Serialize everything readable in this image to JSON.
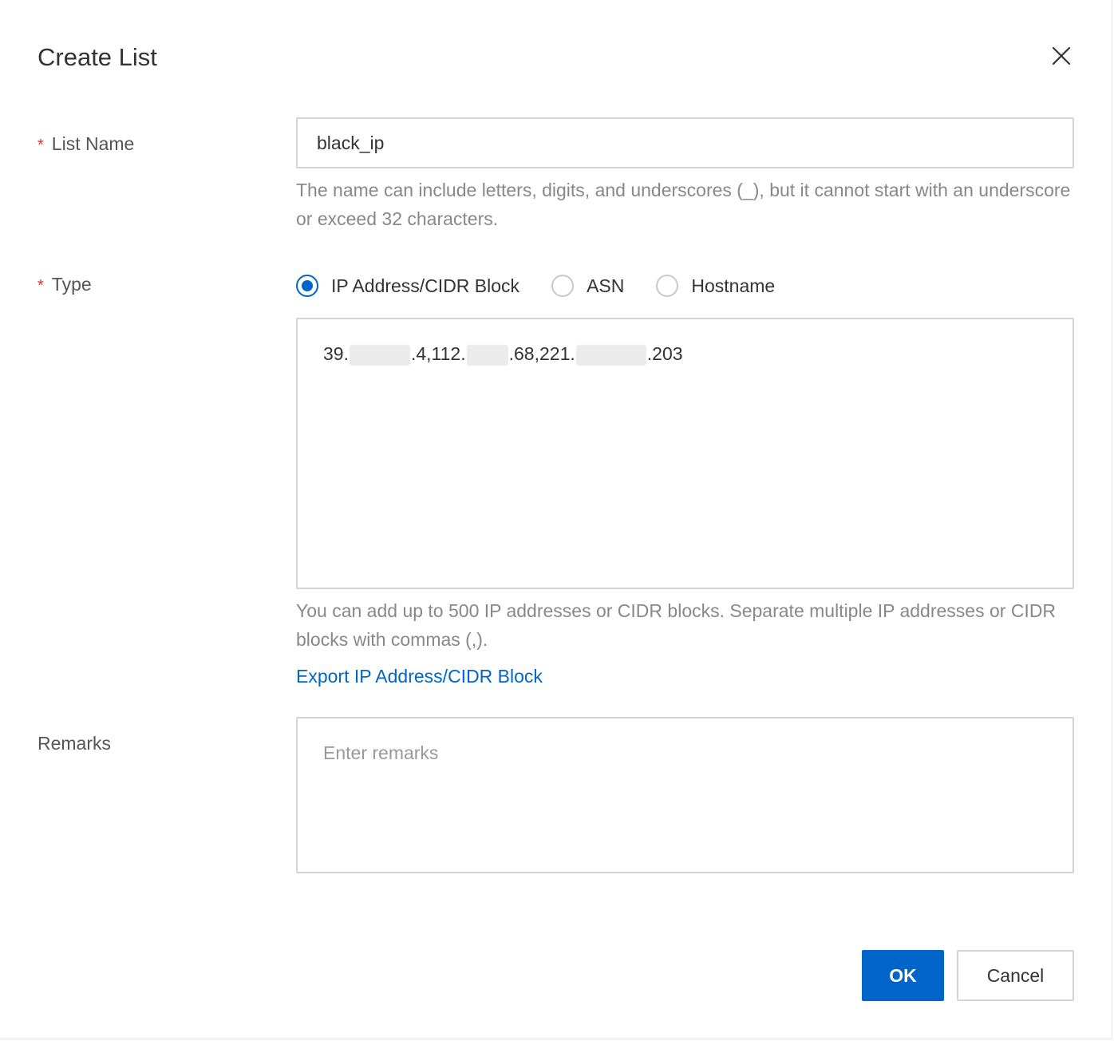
{
  "dialog": {
    "title": "Create List",
    "close_icon": "close-icon"
  },
  "list_name": {
    "required_mark": "*",
    "label": "List Name",
    "value": "black_ip",
    "help": "The name can include letters, digits, and underscores (_), but it cannot start with an underscore or exceed 32 characters."
  },
  "type": {
    "required_mark": "*",
    "label": "Type",
    "options": [
      {
        "label": "IP Address/CIDR Block",
        "checked": true
      },
      {
        "label": "ASN",
        "checked": false
      },
      {
        "label": "Hostname",
        "checked": false
      }
    ],
    "ip_value_parts": [
      "39.",
      ".4,112.",
      ".68,221.",
      ".203"
    ],
    "help": "You can add up to 500 IP addresses or CIDR blocks. Separate multiple IP addresses or CIDR blocks with commas (,).",
    "export_link": "Export IP Address/CIDR Block"
  },
  "remarks": {
    "label": "Remarks",
    "placeholder": "Enter remarks"
  },
  "footer": {
    "ok_label": "OK",
    "cancel_label": "Cancel"
  },
  "colors": {
    "primary": "#0064c8",
    "required": "#d93026",
    "help_text": "#888888",
    "border": "#d4d4d4"
  }
}
